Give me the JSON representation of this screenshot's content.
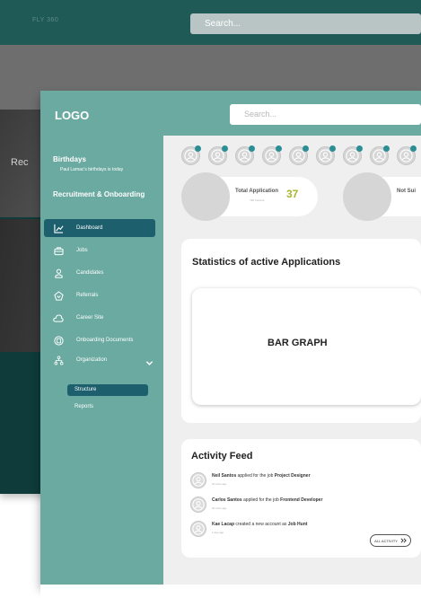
{
  "background_mock": {
    "brand": "FLY 360",
    "search_placeholder": "Search...",
    "hero_text": "Rec"
  },
  "header": {
    "logo": "LOGO",
    "search_placeholder": "Search..."
  },
  "sidebar": {
    "birthdays_title": "Birthdays",
    "birthday_text": "Paul Lamac's birthdays is today",
    "section_title": "Recruitment & Onboarding",
    "items": [
      {
        "label": "Dashboard",
        "icon": "chart-icon",
        "active": true
      },
      {
        "label": "Jobs",
        "icon": "briefcase-icon"
      },
      {
        "label": "Candidates",
        "icon": "user-icon"
      },
      {
        "label": "Referrals",
        "icon": "handshake-icon"
      },
      {
        "label": "Career Site",
        "icon": "cloud-icon"
      },
      {
        "label": "Onboarding Documents",
        "icon": "document-icon"
      },
      {
        "label": "Organization",
        "icon": "org-chart-icon"
      }
    ],
    "sub_items": [
      {
        "label": "Structure",
        "active": true
      },
      {
        "label": "Reports"
      }
    ]
  },
  "stats": {
    "total_application_label": "Total Application",
    "total_application_value": "37",
    "total_application_sub": "728 Content",
    "not_suitable_label": "Not Sui"
  },
  "statistics_panel": {
    "title": "Statistics of active Applications",
    "placeholder": "BAR GRAPH"
  },
  "activity_feed": {
    "title": "Activity Feed",
    "items": [
      {
        "name": "Neil Santos",
        "text": "applied for the job",
        "target": "Project Designer",
        "time": "20 mins ago"
      },
      {
        "name": "Carlos Santos",
        "text": "applied for the job",
        "target": "Frontend Developer",
        "time": "20 mins ago"
      },
      {
        "name": "Kae Lacap",
        "text": "created a new account as",
        "target": "Job Hunt",
        "time": "1 day ago"
      }
    ],
    "all_button": "ALL ACTIVITY"
  },
  "colors": {
    "teal": "#6aaaa1",
    "active_nav": "#1d5f6d",
    "accent_number": "#a7b62d",
    "notification_dot": "#2c8e95"
  }
}
